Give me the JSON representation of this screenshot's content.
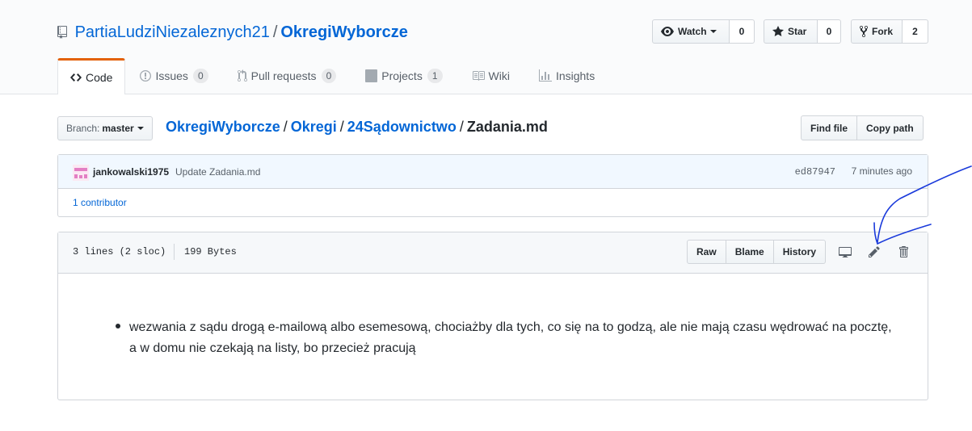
{
  "repo": {
    "owner": "PartiaLudziNiezaleznych21",
    "separator": "/",
    "name": "OkregiWyborcze"
  },
  "actions": {
    "watch": {
      "label": "Watch",
      "count": "0"
    },
    "star": {
      "label": "Star",
      "count": "0"
    },
    "fork": {
      "label": "Fork",
      "count": "2"
    }
  },
  "tabs": [
    {
      "label": "Code",
      "icon": "code-icon",
      "selected": true
    },
    {
      "label": "Issues",
      "count": "0",
      "icon": "issue-icon"
    },
    {
      "label": "Pull requests",
      "count": "0",
      "icon": "pull-request-icon"
    },
    {
      "label": "Projects",
      "count": "1",
      "icon": "project-icon"
    },
    {
      "label": "Wiki",
      "icon": "book-icon"
    },
    {
      "label": "Insights",
      "icon": "graph-icon"
    }
  ],
  "branch": {
    "prefix": "Branch:",
    "name": "master"
  },
  "breadcrumb": {
    "parts": [
      "OkregiWyborcze",
      "Okregi",
      "24Sądownictwo"
    ],
    "separator": "/",
    "file": "Zadania.md"
  },
  "file_nav": {
    "find_file": "Find file",
    "copy_path": "Copy path"
  },
  "commit": {
    "author": "jankowalski1975",
    "message": "Update Zadania.md",
    "sha": "ed87947",
    "ago": "7 minutes ago",
    "contributors": "1 contributor"
  },
  "file_info": {
    "lines": "3 lines (2 sloc)",
    "size": "199 Bytes"
  },
  "file_actions": {
    "raw": "Raw",
    "blame": "Blame",
    "history": "History"
  },
  "content": {
    "bullet": "wezwania z sądu drogą e-mailową albo esemesową, chociażby dla tych, co się na to godzą, ale nie mają czasu wędrować na pocztę, a w domu nie czekają na listy, bo przecież pracują"
  },
  "colors": {
    "link": "#0366d6",
    "tab_accent": "#e36209",
    "annotation": "#1a3adb"
  }
}
